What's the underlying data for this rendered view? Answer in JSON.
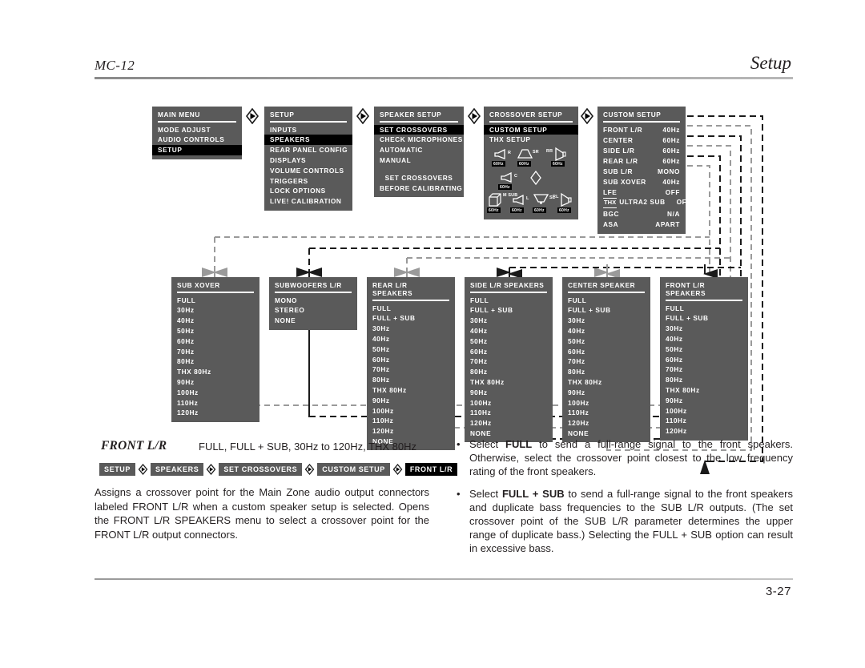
{
  "header": {
    "model": "MC-12",
    "section": "Setup",
    "page_number": "3-27"
  },
  "flow_top": {
    "main_menu": {
      "title": "MAIN MENU",
      "items": [
        {
          "label": "MODE ADJUST",
          "selected": false
        },
        {
          "label": "AUDIO CONTROLS",
          "selected": false
        },
        {
          "label": "SETUP",
          "selected": true
        }
      ]
    },
    "setup": {
      "title": "SETUP",
      "items": [
        {
          "label": "INPUTS",
          "selected": false
        },
        {
          "label": "SPEAKERS",
          "selected": true
        },
        {
          "label": "REAR PANEL CONFIG",
          "selected": false
        },
        {
          "label": "DISPLAYS",
          "selected": false
        },
        {
          "label": "VOLUME CONTROLS",
          "selected": false
        },
        {
          "label": "TRIGGERS",
          "selected": false
        },
        {
          "label": "LOCK OPTIONS",
          "selected": false
        },
        {
          "label": "LIVE! CALIBRATION",
          "selected": false
        }
      ]
    },
    "speaker_setup": {
      "title": "SPEAKER SETUP",
      "items": [
        {
          "label": "SET CROSSOVERS",
          "selected": true
        },
        {
          "label": "CHECK MICROPHONES",
          "selected": false
        },
        {
          "label": "AUTOMATIC",
          "selected": false
        },
        {
          "label": "MANUAL",
          "selected": false
        }
      ],
      "footer_lines": [
        "SET CROSSOVERS",
        "BEFORE CALIBRATING"
      ]
    },
    "crossover_setup": {
      "title": "CROSSOVER SETUP",
      "items": [
        {
          "label": "CUSTOM SETUP",
          "selected": true
        },
        {
          "label": "THX SETUP",
          "selected": false
        }
      ],
      "speaker_diagram": [
        {
          "icon": "speaker-right-icon",
          "label": "R",
          "badge": "60Hz"
        },
        {
          "icon": "speaker-surround-icon",
          "label": "SR",
          "badge": "60Hz"
        },
        {
          "icon": "speaker-rear-right-icon",
          "label": "RR",
          "badge": "60Hz"
        },
        {
          "icon": "speaker-center-icon",
          "label": "C",
          "badge": "60Hz"
        },
        {
          "icon": "listener-position-icon",
          "label": "",
          "badge": ""
        },
        {
          "icon": "subwoofer-cube-icon",
          "label": "M SUB",
          "badge": "60Hz"
        },
        {
          "icon": "speaker-left-icon",
          "label": "L",
          "badge": "60Hz"
        },
        {
          "icon": "speaker-side-left-icon",
          "label": "SL",
          "badge": "60Hz"
        },
        {
          "icon": "speaker-rear-left-icon",
          "label": "RL",
          "badge": "60Hz"
        }
      ]
    },
    "custom_setup": {
      "title": "CUSTOM SETUP",
      "rows": [
        {
          "label": "FRONT L/R",
          "value": "40Hz",
          "thx": false
        },
        {
          "label": "CENTER",
          "value": "60Hz",
          "thx": false
        },
        {
          "label": "SIDE L/R",
          "value": "60Hz",
          "thx": false
        },
        {
          "label": "REAR L/R",
          "value": "60Hz",
          "thx": false
        },
        {
          "label": "SUB L/R",
          "value": "MONO",
          "thx": false
        },
        {
          "label": "SUB XOVER",
          "value": "40Hz",
          "thx": false
        },
        {
          "label": "LFE",
          "value": "OFF",
          "thx": false
        },
        {
          "label": "ULTRA2 SUB",
          "value": "OFF",
          "thx": true
        },
        {
          "label": "BGC",
          "value": "N/A",
          "thx": false
        },
        {
          "label": "ASA",
          "value": "APART",
          "thx": false
        }
      ]
    }
  },
  "flow_bottom": [
    {
      "title": "SUB XOVER",
      "items": [
        "FULL",
        "30Hz",
        "40Hz",
        "50Hz",
        "60Hz",
        "70Hz",
        "80Hz",
        "THX 80Hz",
        "90Hz",
        "100Hz",
        "110Hz",
        "120Hz"
      ]
    },
    {
      "title": "SUBWOOFERS L/R",
      "items": [
        "MONO",
        "STEREO",
        "NONE"
      ]
    },
    {
      "title": "REAR L/R SPEAKERS",
      "items": [
        "FULL",
        "FULL + SUB",
        "30Hz",
        "40Hz",
        "50Hz",
        "60Hz",
        "70Hz",
        "80Hz",
        "THX 80Hz",
        "90Hz",
        "100Hz",
        "110Hz",
        "120Hz",
        "NONE"
      ]
    },
    {
      "title": "SIDE L/R SPEAKERS",
      "items": [
        "FULL",
        "FULL + SUB",
        "30Hz",
        "40Hz",
        "50Hz",
        "60Hz",
        "70Hz",
        "80Hz",
        "THX 80Hz",
        "90Hz",
        "100Hz",
        "110Hz",
        "120Hz",
        "NONE"
      ]
    },
    {
      "title": "CENTER SPEAKER",
      "items": [
        "FULL",
        "FULL + SUB",
        "30Hz",
        "40Hz",
        "50Hz",
        "60Hz",
        "70Hz",
        "80Hz",
        "THX 80Hz",
        "90Hz",
        "100Hz",
        "110Hz",
        "120Hz",
        "NONE"
      ]
    },
    {
      "title": "FRONT L/R SPEAKERS",
      "items": [
        "FULL",
        "FULL + SUB",
        "30Hz",
        "40Hz",
        "50Hz",
        "60Hz",
        "70Hz",
        "80Hz",
        "THX 80Hz",
        "90Hz",
        "100Hz",
        "110Hz",
        "120Hz"
      ]
    }
  ],
  "parameter": {
    "name": "FRONT L/R",
    "range": "FULL, FULL + SUB, 30Hz to 120Hz, THX 80Hz",
    "breadcrumb": [
      "SETUP",
      "SPEAKERS",
      "SET CROSSOVERS",
      "CUSTOM SETUP",
      "FRONT L/R"
    ],
    "description": "Assigns a crossover point for the Main Zone audio output connectors labeled FRONT L/R when a custom speaker setup is selected. Opens the FRONT L/R SPEAKERS menu to select a crossover point for the FRONT L/R output connectors.",
    "bullets": [
      {
        "parts": [
          {
            "t": "Select ",
            "b": false
          },
          {
            "t": "FULL",
            "b": true
          },
          {
            "t": " to send a full-range signal to the front speakers. Otherwise, select the crossover point closest to the low frequency rating of the front speakers.",
            "b": false
          }
        ]
      },
      {
        "parts": [
          {
            "t": "Select ",
            "b": false
          },
          {
            "t": "FULL + SUB",
            "b": true
          },
          {
            "t": " to send a full-range signal to the front speakers and duplicate bass frequencies to the SUB L/R outputs. (The set crossover point of the SUB L/R parameter determines the upper range of duplicate bass.) Selecting the FULL + SUB option can result in excessive bass.",
            "b": false
          }
        ]
      }
    ]
  },
  "colors": {
    "osd_bg": "#5a5a5a",
    "osd_selected": "#000000",
    "text": "#231f20",
    "dash_gray": "#9a9a9a",
    "dash_black": "#1a1a1a"
  }
}
